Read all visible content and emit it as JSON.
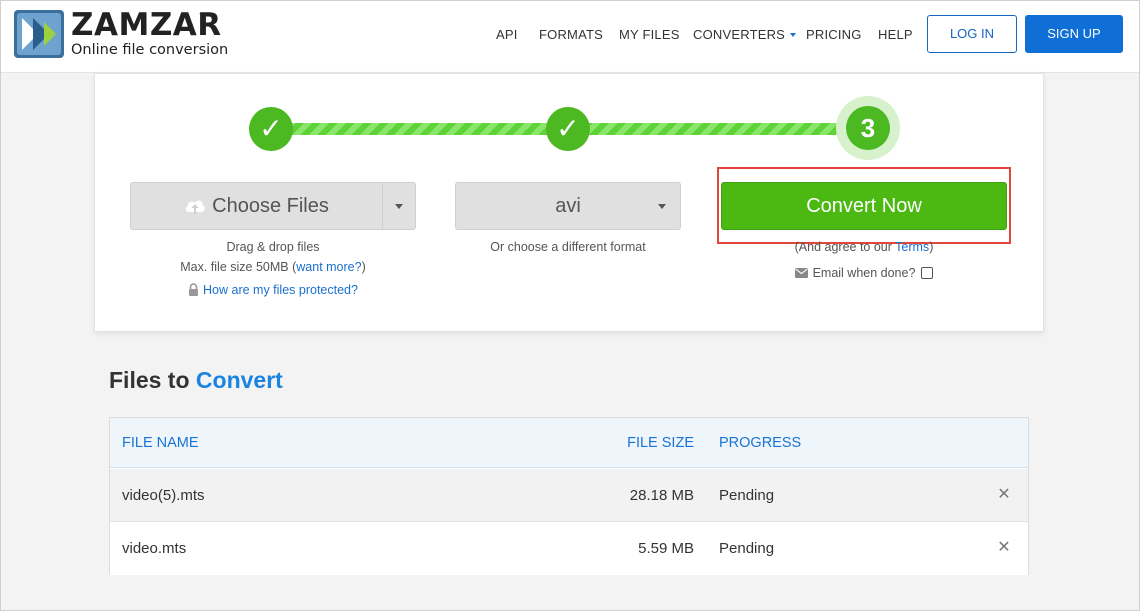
{
  "header": {
    "logo_name": "ZAMZAR",
    "logo_tm": "™",
    "logo_tagline": "Online file conversion",
    "nav": [
      "API",
      "FORMATS",
      "MY FILES",
      "CONVERTERS",
      "PRICING",
      "HELP"
    ],
    "login_label": "LOG IN",
    "signup_label": "SIGN UP"
  },
  "steps": {
    "step1_symbol": "✓",
    "step2_symbol": "✓",
    "step3_number": "3"
  },
  "choose_files": {
    "label": "Choose Files",
    "drag_drop": "Drag & drop files",
    "max_size": "Max. file size 50MB",
    "want_more": "want more?",
    "protected_link": "How are my files protected?"
  },
  "format": {
    "selected": "avi",
    "hint": "Or choose a different format"
  },
  "convert": {
    "label": "Convert Now",
    "agree_prefix": "(And agree to our ",
    "terms": "Terms",
    "agree_suffix": ")",
    "email_label": "Email when done?"
  },
  "files_section": {
    "title_part1": "Files to",
    "title_part2": "Convert",
    "columns": [
      "FILE NAME",
      "FILE SIZE",
      "PROGRESS"
    ],
    "rows": [
      {
        "name": "video(5).mts",
        "size": "28.18 MB",
        "progress": "Pending"
      },
      {
        "name": "video.mts",
        "size": "5.59 MB",
        "progress": "Pending"
      }
    ],
    "remove_symbol": "✕"
  },
  "colors": {
    "brand_blue": "#0f6fd6",
    "green": "#4cb812",
    "highlight_red": "#e0463a"
  }
}
